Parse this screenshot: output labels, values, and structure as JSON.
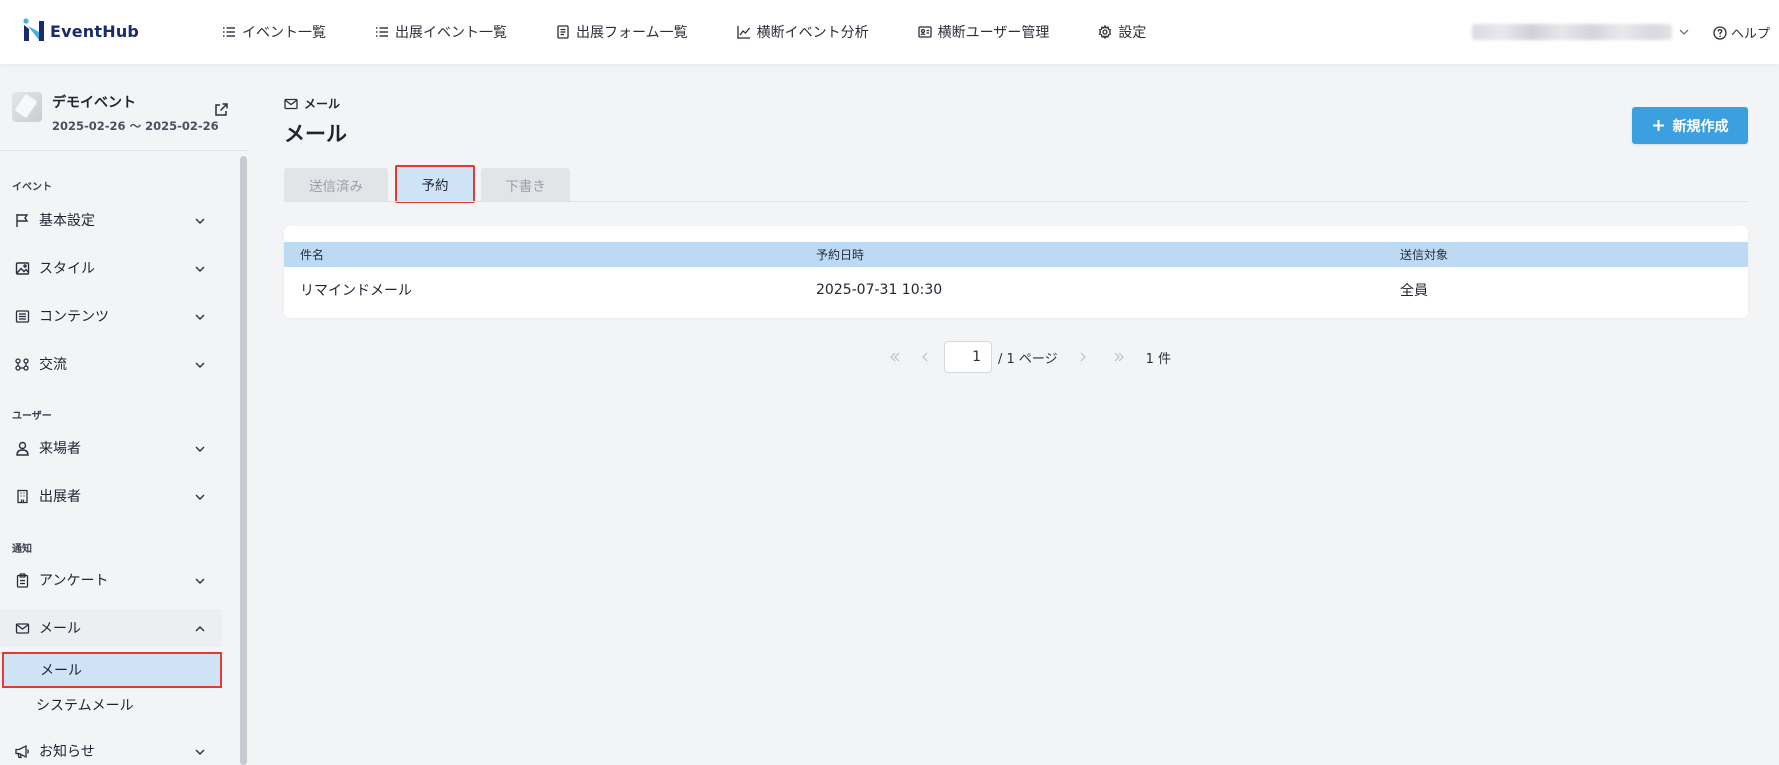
{
  "app": {
    "name": "EventHub",
    "brand_color": "#1a2a6c",
    "accent_color": "#3b9fe0"
  },
  "header": {
    "nav": [
      {
        "label": "イベント一覧",
        "icon": "list-icon"
      },
      {
        "label": "出展イベント一覧",
        "icon": "list-icon"
      },
      {
        "label": "出展フォーム一覧",
        "icon": "form-icon"
      },
      {
        "label": "横断イベント分析",
        "icon": "chart-icon"
      },
      {
        "label": "横断ユーザー管理",
        "icon": "user-card-icon"
      },
      {
        "label": "設定",
        "icon": "gear-icon"
      }
    ],
    "help_label": "ヘルプ"
  },
  "sidebar": {
    "event": {
      "title": "デモイベント",
      "dates": "2025-02-26 〜 2025-02-26"
    },
    "sections": {
      "event": "イベント",
      "users": "ユーザー",
      "notifications": "通知"
    },
    "items": [
      {
        "label": "基本設定",
        "icon": "flag-icon"
      },
      {
        "label": "スタイル",
        "icon": "image-icon"
      },
      {
        "label": "コンテンツ",
        "icon": "content-icon"
      },
      {
        "label": "交流",
        "icon": "network-icon"
      },
      {
        "label": "来場者",
        "icon": "person-icon"
      },
      {
        "label": "出展者",
        "icon": "building-icon"
      },
      {
        "label": "アンケート",
        "icon": "clipboard-icon"
      },
      {
        "label": "メール",
        "icon": "mail-icon"
      },
      {
        "label": "お知らせ",
        "icon": "megaphone-icon"
      }
    ],
    "mail_sub": [
      {
        "label": "メール",
        "active": true
      },
      {
        "label": "システムメール",
        "active": false
      }
    ]
  },
  "main": {
    "breadcrumb": "メール",
    "title": "メール",
    "new_button": "新規作成",
    "tabs": [
      {
        "label": "送信済み",
        "selected": false
      },
      {
        "label": "予約",
        "selected": true
      },
      {
        "label": "下書き",
        "selected": false
      }
    ],
    "table": {
      "columns": [
        "件名",
        "予約日時",
        "送信対象"
      ],
      "rows": [
        [
          "リマインドメール",
          "2025-07-31 10:30",
          "全員"
        ]
      ]
    },
    "pagination": {
      "current": "1",
      "total_label": "/ 1 ページ",
      "count_label": "1 件"
    }
  }
}
